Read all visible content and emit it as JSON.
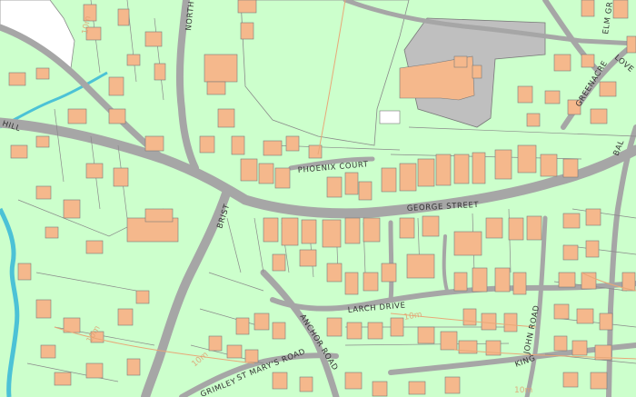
{
  "map": {
    "colors": {
      "land": "#ccffcc",
      "road": "#a6a6a6",
      "building": "#f5b88c",
      "building_edge": "#7a7a7a",
      "water": "#4cc2d6",
      "open_space": "#eefce6",
      "contour": "#e8a878"
    },
    "street_labels": [
      {
        "key": "george",
        "text": "GEORGE STREET"
      },
      {
        "key": "phoenix",
        "text": "PHOENIX   COURT"
      },
      {
        "key": "larch",
        "text": "LARCH DRIVE"
      },
      {
        "key": "anchor",
        "text": "ANCHOR ROAD"
      },
      {
        "key": "stmarys",
        "text": "ST MARY'S ROAD"
      },
      {
        "key": "king",
        "text": "KING"
      },
      {
        "key": "john",
        "text": "JOHN ROAD"
      },
      {
        "key": "north",
        "text": "NORTH"
      },
      {
        "key": "brist",
        "text": "BRIST"
      },
      {
        "key": "hill",
        "text": "HILL"
      },
      {
        "key": "grimley",
        "text": "GRIMLEY"
      },
      {
        "key": "greenacre",
        "text": "GREENACRE"
      },
      {
        "key": "elm",
        "text": "ELM GR"
      },
      {
        "key": "love",
        "text": "LOVE"
      },
      {
        "key": "bal",
        "text": "BAL"
      }
    ],
    "contour_labels": [
      {
        "key": "c1",
        "text": "10m"
      },
      {
        "key": "c2",
        "text": "10m"
      },
      {
        "key": "c3",
        "text": "10m"
      },
      {
        "key": "c4",
        "text": "10m"
      },
      {
        "key": "c5",
        "text": "10m"
      }
    ]
  }
}
